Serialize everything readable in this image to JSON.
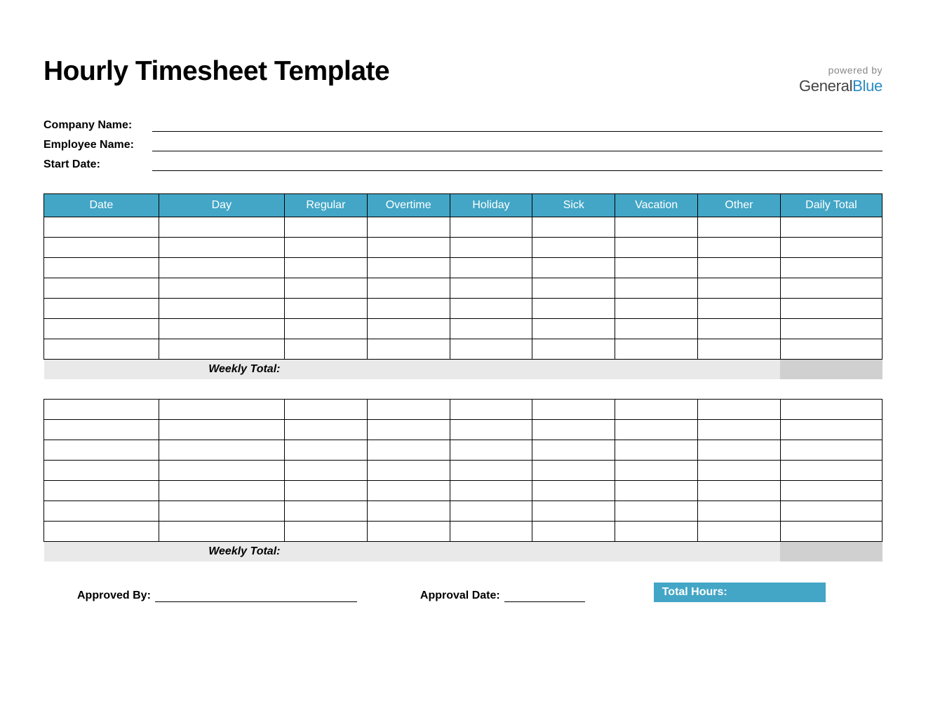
{
  "header": {
    "title": "Hourly Timesheet Template",
    "powered_by": "powered by",
    "brand_a": "General",
    "brand_b": "Blue"
  },
  "info": {
    "company_label": "Company Name:",
    "employee_label": "Employee Name:",
    "start_date_label": "Start Date:"
  },
  "table": {
    "headers": [
      "Date",
      "Day",
      "Regular",
      "Overtime",
      "Holiday",
      "Sick",
      "Vacation",
      "Other",
      "Daily Total"
    ],
    "weekly_total_label": "Weekly Total:"
  },
  "footer": {
    "approved_by_label": "Approved By:",
    "approval_date_label": "Approval Date:",
    "total_hours_label": "Total Hours:"
  }
}
